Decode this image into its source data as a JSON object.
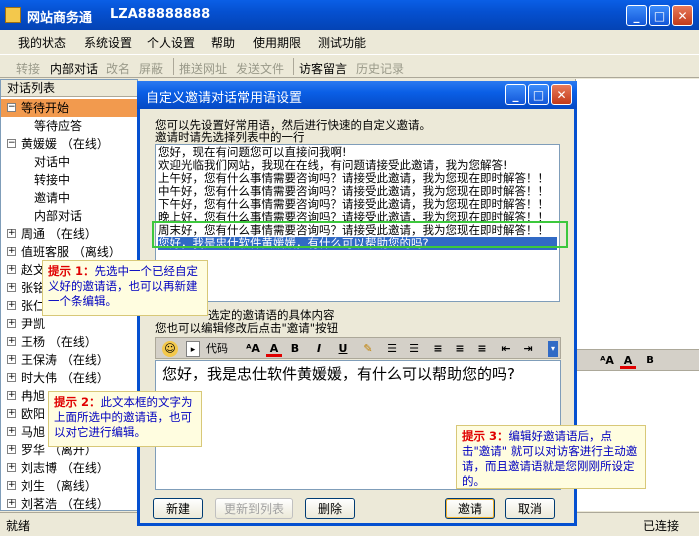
{
  "window": {
    "title": "网站商务通",
    "user": "LZA88888888",
    "min": "_",
    "max": "□",
    "close": "✕"
  },
  "menu": [
    "我的状态",
    "系统设置",
    "个人设置",
    "帮助",
    "使用期限",
    "测试功能"
  ],
  "toolbar": {
    "items": [
      "转接",
      "内部对话",
      "改名",
      "屏蔽",
      "推送网址",
      "发送文件",
      "访客留言",
      "历史记录"
    ]
  },
  "left_panel": {
    "header": "对话列表",
    "rows": [
      "等待开始",
      "等待应答",
      "黄媛媛 （在线）",
      "对话中",
      "转接中",
      "邀请中",
      "内部对话",
      "周通 （在线）",
      "值班客服 （离线）",
      "赵文",
      "张铭",
      "张仁",
      "尹凯",
      "王杨 （在线）",
      "王保涛 （在线）",
      "时大伟 （在线）",
      "冉旭",
      "欧阳",
      "马旭",
      "罗华 （离开）",
      "刘志博 （在线）",
      "刘生 （离线）",
      "刘茗浩 （在线）"
    ]
  },
  "dialog": {
    "title": "自定义邀请对话常用语设置",
    "desc1": "您可以先设置好常用语，然后进行快速的自定义邀请。",
    "desc2": "邀请时请先选择列表中的一行",
    "list": [
      "您好，现在有问题您可以直接问我啊!",
      "欢迎光临我们网站，我现在在线，有问题请接受此邀请，我为您解答!",
      "上午好，您有什么事情需要咨询吗？请接受此邀请，我为您现在即时解答！！",
      "中午好，您有什么事情需要咨询吗？请接受此邀请，我为您现在即时解答！！",
      "下午好，您有什么事情需要咨询吗？请接受此邀请，我为您现在即时解答！！",
      "晚上好，您有什么事情需要咨询吗？请接受此邀请，我为您现在即时解答！！",
      "周末好，您有什么事情需要咨询吗？请接受此邀请，我为您现在即时解答！！",
      "您好，我是忠仕软件黄媛媛，有什么可以帮助您的吗?"
    ],
    "label_content": "选定的邀请语的具体内容",
    "label_edit": "您也可以编辑修改后点击\"邀请\"按钮",
    "editor_code_label": "代码",
    "editor_text": "您好，我是忠仕软件黄媛媛，有什么可以帮助您的吗?",
    "buttons": {
      "new": "新建",
      "update": "更新到列表",
      "delete": "删除",
      "invite": "邀请",
      "cancel": "取消"
    }
  },
  "tips": {
    "tip1_label": "提示 1：",
    "tip1_text": "先选中一个已经自定义好的邀请语，也可以再新建一个条编辑。",
    "tip2_label": "提示 2：",
    "tip2_text": "此文本框的文字为上面所选中的邀请语，也可以对它进行编辑。",
    "tip3_label": "提示 3：",
    "tip3_text": "编辑好邀请语后，点击\"邀请\" 就可以对访客进行主动邀请，而且邀请语就是您刚刚所设定的。"
  },
  "status": {
    "left": "就绪",
    "right": "已连接"
  },
  "colors": {
    "title_blue": "#0550d0",
    "selected_row": "#f29a4e",
    "tip_red": "#e00000",
    "tip_blue": "#0000c0",
    "highlight_green": "#3cc83c"
  }
}
